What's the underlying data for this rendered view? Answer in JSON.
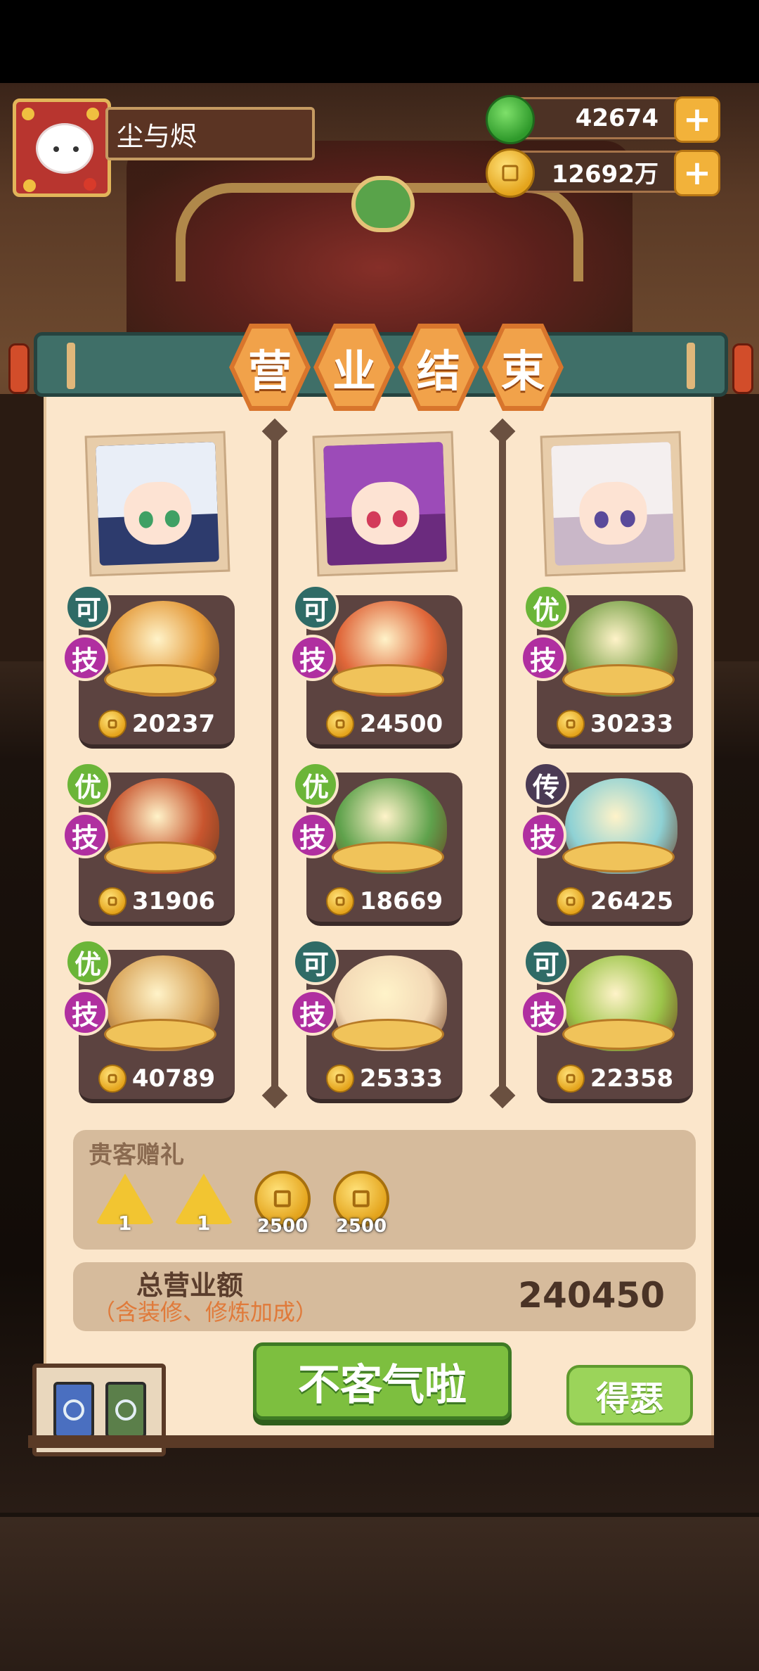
{
  "player": {
    "name": "尘与烬"
  },
  "resources": {
    "gems": "42674",
    "coins": "12692万"
  },
  "title_chars": [
    "营",
    "业",
    "结",
    "束"
  ],
  "chefs": [
    {
      "colors": [
        "#e9eef7",
        "#2d3b6d"
      ]
    },
    {
      "colors": [
        "#9c4bb8",
        "#6b2b7e"
      ]
    },
    {
      "colors": [
        "#f4efef",
        "#c9b7c8"
      ]
    }
  ],
  "dishes": [
    {
      "grade": "可",
      "grade_color": "ke",
      "skill": "技",
      "price": "20237",
      "color": "#e49a3a"
    },
    {
      "grade": "可",
      "grade_color": "ke",
      "skill": "技",
      "price": "24500",
      "color": "#e0673a"
    },
    {
      "grade": "优",
      "grade_color": "you",
      "skill": "技",
      "price": "30233",
      "color": "#7aa24a"
    },
    {
      "grade": "优",
      "grade_color": "you",
      "skill": "技",
      "price": "31906",
      "color": "#c8552e"
    },
    {
      "grade": "优",
      "grade_color": "you",
      "skill": "技",
      "price": "18669",
      "color": "#5fa24c"
    },
    {
      "grade": "传",
      "grade_color": "chuan",
      "skill": "技",
      "price": "26425",
      "color": "#8ed1d4"
    },
    {
      "grade": "优",
      "grade_color": "you",
      "skill": "技",
      "price": "40789",
      "color": "#d9a55a"
    },
    {
      "grade": "可",
      "grade_color": "ke",
      "skill": "技",
      "price": "25333",
      "color": "#f3d9b6"
    },
    {
      "grade": "可",
      "grade_color": "ke",
      "skill": "技",
      "price": "22358",
      "color": "#9cc54a"
    }
  ],
  "gifts": {
    "title": "贵客赠礼",
    "items": [
      {
        "type": "token",
        "count": "1"
      },
      {
        "type": "token",
        "count": "1"
      },
      {
        "type": "coin",
        "count": "2500"
      },
      {
        "type": "coin",
        "count": "2500"
      }
    ]
  },
  "total": {
    "label": "总营业额",
    "sub": "（含装修、修炼加成）",
    "value": "240450"
  },
  "buttons": {
    "confirm": "不客气啦",
    "share": "得瑟"
  },
  "background": {
    "menu_sign": "菜单"
  }
}
